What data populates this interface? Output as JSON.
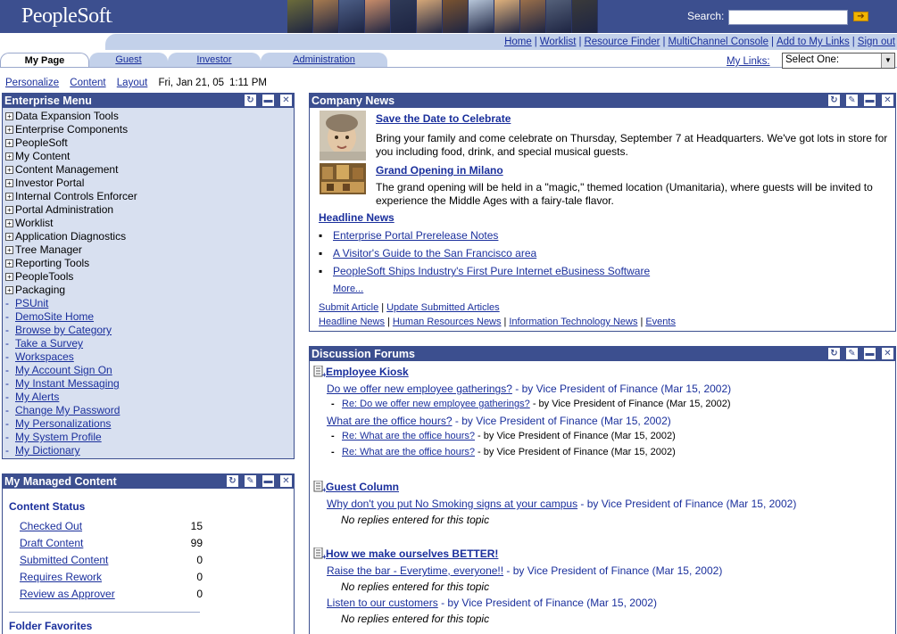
{
  "header": {
    "logo": "PeopleSoft",
    "logo_mark": ".",
    "search_label": "Search:",
    "search_value": "",
    "search_go": "➔",
    "photo_colors": [
      "#6b6b3a",
      "#a87b4f",
      "#4c5e86",
      "#c98d6a",
      "#2f3a57",
      "#d6a878",
      "#7a5330",
      "#b7c6d9",
      "#e0b27c",
      "#9a6f4a",
      "#546079",
      "#3a3a3a"
    ]
  },
  "toplinks": [
    "Home",
    "Worklist",
    "Resource Finder",
    "MultiChannel Console",
    "Add to My Links",
    "Sign out"
  ],
  "tabs": [
    "My Page",
    "Guest",
    "Investor",
    "Administration"
  ],
  "mylinks": {
    "label": "My Links:",
    "selected": "Select One:"
  },
  "personalize": {
    "personalize": "Personalize",
    "content": "Content",
    "layout": "Layout",
    "date": "Fri, Jan 21, 05",
    "time": "1:11 PM"
  },
  "enterprise_menu": {
    "title": "Enterprise Menu",
    "folders": [
      "Data Expansion Tools",
      "Enterprise Components",
      "PeopleSoft",
      "My Content",
      "Content Management",
      "Investor Portal",
      "Internal Controls Enforcer",
      "Portal Administration",
      "Worklist",
      "Application Diagnostics",
      "Tree Manager",
      "Reporting Tools",
      "PeopleTools",
      "Packaging"
    ],
    "links": [
      "PSUnit",
      "DemoSite Home",
      "Browse by Category",
      "Take a Survey",
      "Workspaces",
      "My Account Sign On",
      "My Instant Messaging",
      "My Alerts",
      "Change My Password",
      "My Personalizations",
      "My System Profile",
      "My Dictionary"
    ]
  },
  "managed": {
    "title": "My Managed Content",
    "section": "Content Status",
    "rows": [
      {
        "label": "Checked Out",
        "count": "15"
      },
      {
        "label": "Draft Content",
        "count": "99"
      },
      {
        "label": "Submitted Content",
        "count": "0"
      },
      {
        "label": "Requires Rework",
        "count": "0"
      },
      {
        "label": "Review as Approver",
        "count": "0"
      }
    ],
    "folder": "Folder Favorites"
  },
  "news": {
    "title": "Company News",
    "items": [
      {
        "title": "Save the Date to Celebrate",
        "body": "Bring your family and come celebrate on Thursday, September 7 at Headquarters. We've got lots in store for you including food, drink, and special musical guests."
      },
      {
        "title": "Grand Opening in Milano",
        "body": "The grand opening will be held in a \"magic,\" themed location (Umanitaria), where guests will be invited to experience the Middle Ages with a fairy-tale flavor."
      }
    ],
    "headline_title": "Headline News",
    "bullet": "▪",
    "headlines": [
      "Enterprise Portal Prerelease Notes",
      "A Visitor's Guide to the San Francisco area",
      "PeopleSoft Ships Industry's First Pure Internet eBusiness Software"
    ],
    "more": "More...",
    "actions": [
      "Submit Article",
      "Update Submitted Articles"
    ],
    "categories": [
      "Headline News",
      "Human Resources News",
      "Information Technology News",
      "Events"
    ]
  },
  "forums": {
    "title": "Discussion Forums",
    "forum1": {
      "name": "Employee Kiosk",
      "topic1": {
        "title": "Do we offer new employee gatherings?",
        "by": " - by Vice President of Finance (Mar 15, 2002)"
      },
      "reply1": {
        "title": "Re: Do we offer new employee gatherings?",
        "by": " - by Vice President of Finance (Mar 15, 2002)"
      },
      "topic2": {
        "title": "What are the office hours?",
        "by": " - by Vice President of Finance (Mar 15, 2002)"
      },
      "reply2": {
        "title": "Re: What are the office hours?",
        "by": " - by Vice President of Finance (Mar 15, 2002)"
      },
      "reply3": {
        "title": "Re: What are the office hours?",
        "by": " - by Vice President of Finance (Mar 15, 2002)"
      }
    },
    "forum2": {
      "name": "Guest Column",
      "topic1": {
        "title": "Why don't you put No Smoking signs at your campus",
        "by": " - by Vice President of Finance (Mar 15, 2002)"
      },
      "none": "No replies entered for this topic"
    },
    "forum3": {
      "name": "How we make ourselves BETTER!",
      "topic1": {
        "title": "Raise the bar - Everytime, everyone!!",
        "by": " - by Vice President of Finance (Mar 15, 2002)"
      },
      "none1": "No replies entered for this topic",
      "topic2": {
        "title": "Listen to our customers",
        "by": " - by Vice President of Finance (Mar 15, 2002)"
      },
      "none2": "No replies entered for this topic"
    }
  },
  "colors": {
    "header": "#3c4f8f",
    "link": "#1a2f9c",
    "menu_bg": "#d8e0f0",
    "bar": "#c3d1ea"
  }
}
